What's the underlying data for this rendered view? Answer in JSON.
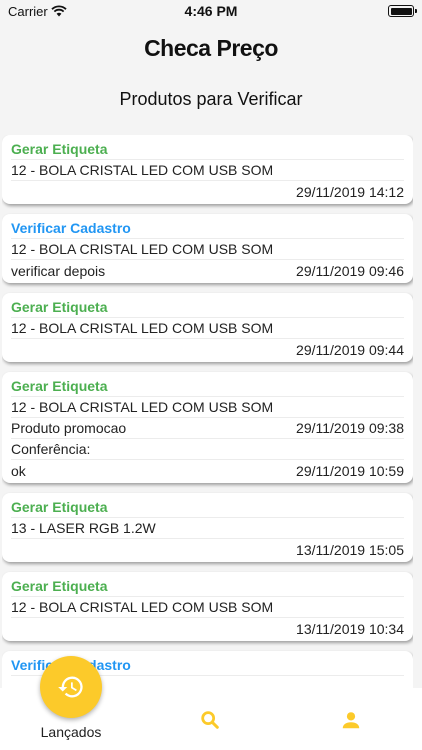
{
  "status_bar": {
    "carrier": "Carrier",
    "time": "4:46 PM"
  },
  "app": {
    "title": "Checa Preço",
    "subtitle": "Produtos para Verificar"
  },
  "colors": {
    "gerar": "#4caf50",
    "verificar": "#2196f3",
    "accent": "#fcca2a"
  },
  "cards": [
    {
      "title": "Gerar Etiqueta",
      "product": "12 - BOLA CRISTAL LED COM USB SOM",
      "date": "29/11/2019 14:12"
    },
    {
      "title": "Verificar Cadastro",
      "product": "12 - BOLA CRISTAL LED COM USB SOM",
      "note": "verificar depois",
      "date": "29/11/2019 09:46"
    },
    {
      "title": "Gerar Etiqueta",
      "product": "12 - BOLA CRISTAL LED COM USB SOM",
      "date": "29/11/2019 09:44"
    },
    {
      "title": "Gerar Etiqueta",
      "product": "12 - BOLA CRISTAL LED COM USB SOM",
      "note": "Produto promocao",
      "date": "29/11/2019 09:38",
      "conf_label": "Conferência:",
      "conf_note": "ok",
      "conf_date": "29/11/2019 10:59"
    },
    {
      "title": "Gerar Etiqueta",
      "product": "13 - LASER RGB 1.2W",
      "date": "13/11/2019 15:05"
    },
    {
      "title": "Gerar Etiqueta",
      "product": "12 - BOLA CRISTAL LED COM USB SOM",
      "date": "13/11/2019 10:34"
    },
    {
      "title": "Verificar Cadastro"
    }
  ],
  "tabs": {
    "launched_label": "Lançados",
    "launched_icon": "history-icon",
    "search_icon": "search-icon",
    "profile_icon": "user-icon"
  }
}
